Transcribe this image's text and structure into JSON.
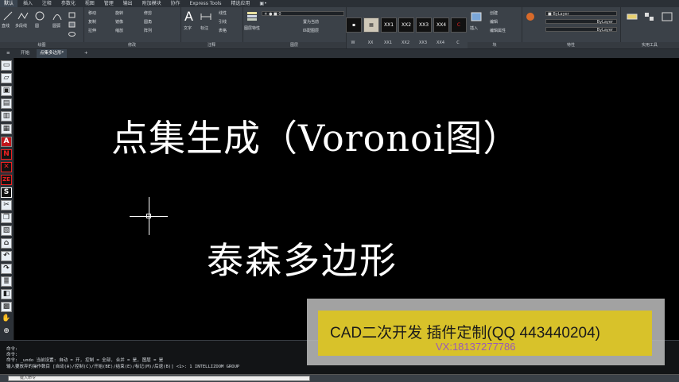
{
  "menu": [
    "默认",
    "插入",
    "注释",
    "参数化",
    "视图",
    "管理",
    "输出",
    "附加模块",
    "协作",
    "Express Tools",
    "精选应用",
    "▣•"
  ],
  "ribbon": {
    "groups": [
      {
        "label": "绘图"
      },
      {
        "label": "修改"
      },
      {
        "label": "注释"
      },
      {
        "label": "图层"
      },
      {
        "label": "块"
      },
      {
        "label": "特性"
      },
      {
        "label": "实用工具"
      }
    ],
    "draw_tools": [
      "直线",
      "多段线",
      "圆",
      "圆弧"
    ],
    "modify_tools": [
      "移动",
      "旋转",
      "修剪",
      "复制",
      "镜像",
      "圆角",
      "拉伸",
      "缩放",
      "阵列"
    ],
    "annot_tools": [
      "文字",
      "标注",
      "线性",
      "引线",
      "表格"
    ],
    "layer_tools": [
      "图层特性",
      "置为当前",
      "匹配图层"
    ],
    "layer_value": "0",
    "block_tools": [
      "插入",
      "创建",
      "编辑",
      "编辑属性"
    ],
    "thumbs": [
      "W",
      "XX",
      "XX1",
      "XX2",
      "XX3",
      "XX4",
      "C"
    ],
    "bylayer": [
      "ByLayer",
      "ByLayer",
      "ByLayer"
    ]
  },
  "tabs": [
    "开始",
    "点集多边形*"
  ],
  "canvas": {
    "title": "点集生成（Voronoi图）",
    "subtitle": "泰森多边形"
  },
  "watermark": {
    "line1": "CAD二次开发 插件定制(QQ 443440204)",
    "line2": "VX:18137277786"
  },
  "command": {
    "lines": [
      "命令:",
      "命令:",
      "命令: _undo 当前设置: 自动 = 开, 控制 = 全部, 合并 = 是, 图层 = 是",
      "输入要放弃的操作数目 [自动(A)/控制(C)/开始(BE)/结束(E)/标记(M)/后退(B)] <1>: 1 INTELLIZOOM GROUP"
    ],
    "placeholder": "键入命令"
  },
  "left_toolbar": [
    "A",
    "N",
    "✕",
    "ZE",
    "S"
  ]
}
